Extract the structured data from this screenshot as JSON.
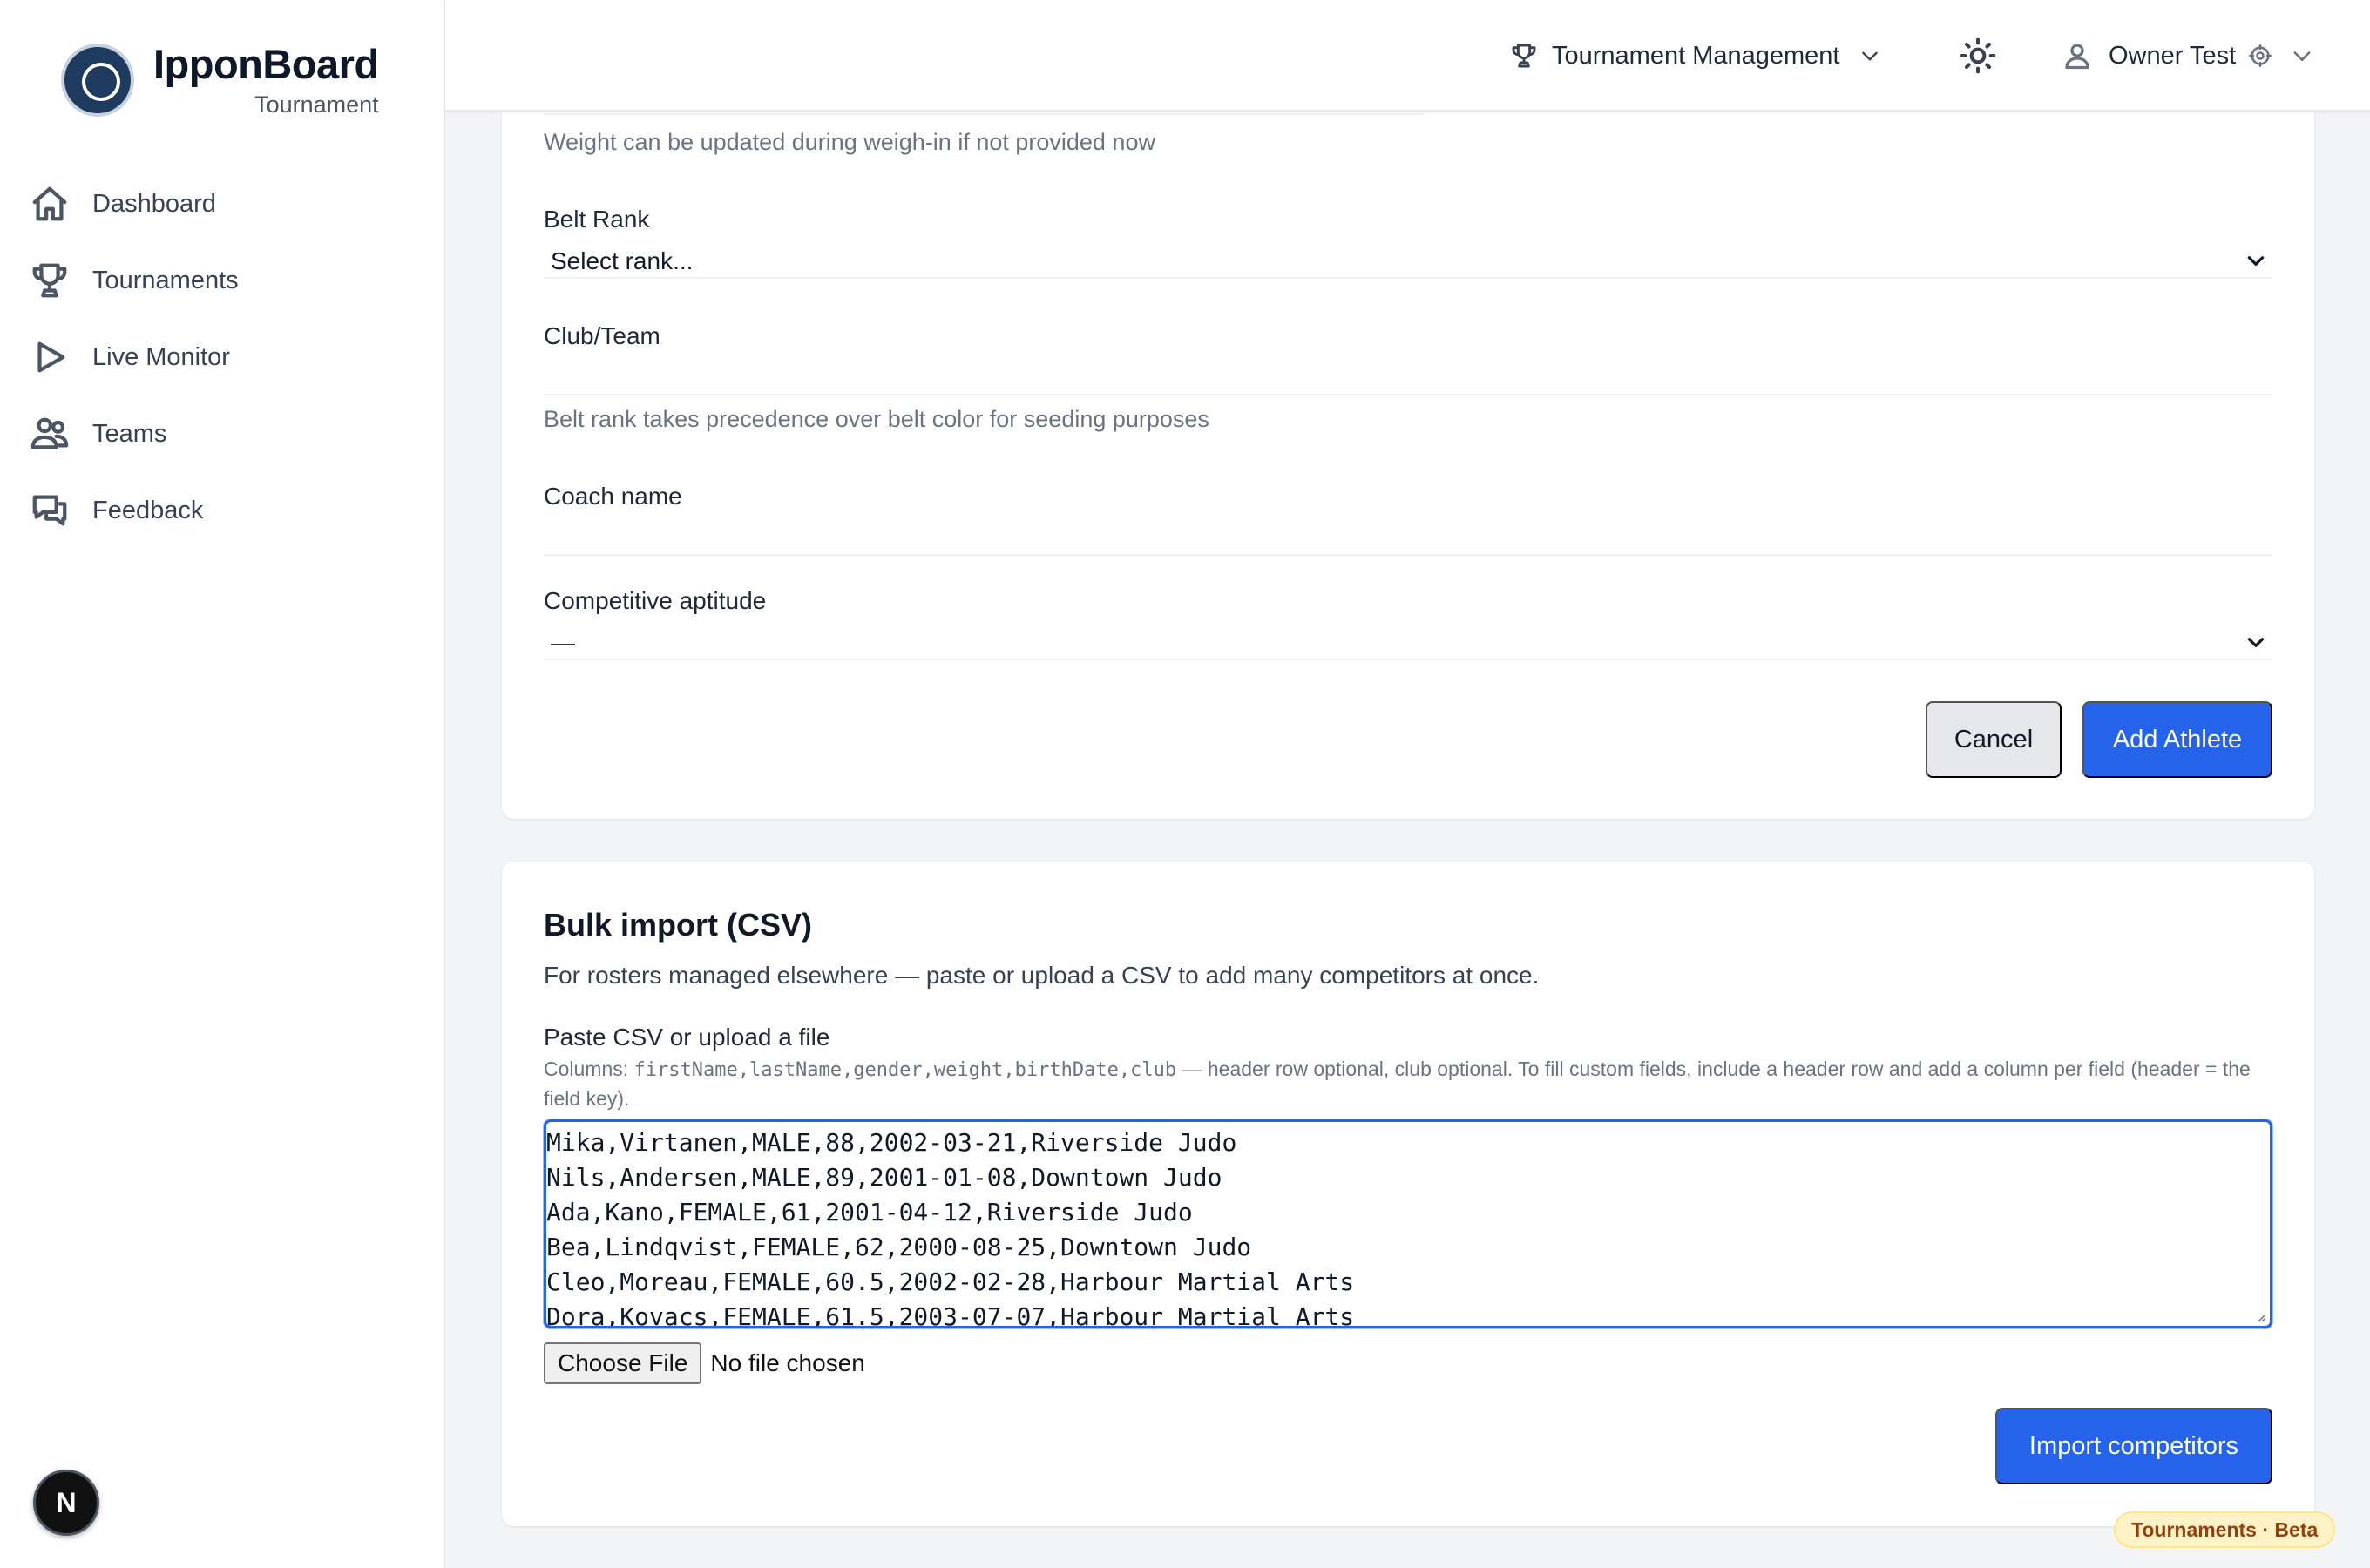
{
  "brand": {
    "name": "IpponBoard",
    "subtitle": "Tournament"
  },
  "sidebar": {
    "items": [
      {
        "label": "Dashboard",
        "icon": "home-icon"
      },
      {
        "label": "Tournaments",
        "icon": "trophy-icon"
      },
      {
        "label": "Live Monitor",
        "icon": "play-icon"
      },
      {
        "label": "Teams",
        "icon": "users-icon"
      },
      {
        "label": "Feedback",
        "icon": "chat-icon"
      }
    ],
    "dev_badge": "N"
  },
  "header": {
    "menu_label": "Tournament Management",
    "user_name": "Owner Test"
  },
  "athlete_form": {
    "weight_help": "Weight can be updated during weigh-in if not provided now",
    "belt_rank_label": "Belt Rank",
    "belt_rank_value": "Select rank...",
    "club_label": "Club/Team",
    "belt_help": "Belt rank takes precedence over belt color for seeding purposes",
    "coach_label": "Coach name",
    "aptitude_label": "Competitive aptitude",
    "aptitude_value": "—",
    "cancel_label": "Cancel",
    "submit_label": "Add Athlete"
  },
  "bulk_import": {
    "title": "Bulk import (CSV)",
    "description": "For rosters managed elsewhere — paste or upload a CSV to add many competitors at once.",
    "field_label": "Paste CSV or upload a file",
    "hint_prefix": "Columns: ",
    "hint_columns": "firstName,lastName,gender,weight,birthDate,club",
    "hint_suffix": " — header row optional, club optional. To fill custom fields, include a header row and add a column per field (header = the field key).",
    "csv_lines": [
      "Mika,Virtanen,MALE,88,2002-03-21,Riverside Judo",
      "Nils,Andersen,MALE,89,2001-01-08,Downtown Judo",
      "Ada,Kano,FEMALE,61,2001-04-12,Riverside Judo",
      "Bea,Lindqvist,FEMALE,62,2000-08-25,Downtown Judo",
      "Cleo,Moreau,FEMALE,60.5,2002-02-28,Harbour Martial Arts",
      "Dora,Kovacs,FEMALE,61.5,2003-07-07,Harbour Martial Arts"
    ],
    "file_button": "Choose File",
    "file_status": "No file chosen",
    "import_label": "Import competitors"
  },
  "beta_badge": "Tournaments · Beta",
  "colors": {
    "primary": "#2563eb",
    "cancel_bg": "#e5e7eb",
    "badge_bg": "#fef3c7"
  }
}
